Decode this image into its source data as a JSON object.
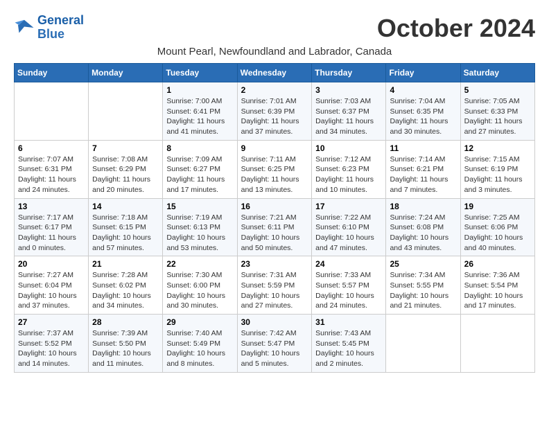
{
  "header": {
    "logo_line1": "General",
    "logo_line2": "Blue",
    "month": "October 2024",
    "subtitle": "Mount Pearl, Newfoundland and Labrador, Canada"
  },
  "weekdays": [
    "Sunday",
    "Monday",
    "Tuesday",
    "Wednesday",
    "Thursday",
    "Friday",
    "Saturday"
  ],
  "weeks": [
    [
      {
        "day": "",
        "info": ""
      },
      {
        "day": "",
        "info": ""
      },
      {
        "day": "1",
        "info": "Sunrise: 7:00 AM\nSunset: 6:41 PM\nDaylight: 11 hours and 41 minutes."
      },
      {
        "day": "2",
        "info": "Sunrise: 7:01 AM\nSunset: 6:39 PM\nDaylight: 11 hours and 37 minutes."
      },
      {
        "day": "3",
        "info": "Sunrise: 7:03 AM\nSunset: 6:37 PM\nDaylight: 11 hours and 34 minutes."
      },
      {
        "day": "4",
        "info": "Sunrise: 7:04 AM\nSunset: 6:35 PM\nDaylight: 11 hours and 30 minutes."
      },
      {
        "day": "5",
        "info": "Sunrise: 7:05 AM\nSunset: 6:33 PM\nDaylight: 11 hours and 27 minutes."
      }
    ],
    [
      {
        "day": "6",
        "info": "Sunrise: 7:07 AM\nSunset: 6:31 PM\nDaylight: 11 hours and 24 minutes."
      },
      {
        "day": "7",
        "info": "Sunrise: 7:08 AM\nSunset: 6:29 PM\nDaylight: 11 hours and 20 minutes."
      },
      {
        "day": "8",
        "info": "Sunrise: 7:09 AM\nSunset: 6:27 PM\nDaylight: 11 hours and 17 minutes."
      },
      {
        "day": "9",
        "info": "Sunrise: 7:11 AM\nSunset: 6:25 PM\nDaylight: 11 hours and 13 minutes."
      },
      {
        "day": "10",
        "info": "Sunrise: 7:12 AM\nSunset: 6:23 PM\nDaylight: 11 hours and 10 minutes."
      },
      {
        "day": "11",
        "info": "Sunrise: 7:14 AM\nSunset: 6:21 PM\nDaylight: 11 hours and 7 minutes."
      },
      {
        "day": "12",
        "info": "Sunrise: 7:15 AM\nSunset: 6:19 PM\nDaylight: 11 hours and 3 minutes."
      }
    ],
    [
      {
        "day": "13",
        "info": "Sunrise: 7:17 AM\nSunset: 6:17 PM\nDaylight: 11 hours and 0 minutes."
      },
      {
        "day": "14",
        "info": "Sunrise: 7:18 AM\nSunset: 6:15 PM\nDaylight: 10 hours and 57 minutes."
      },
      {
        "day": "15",
        "info": "Sunrise: 7:19 AM\nSunset: 6:13 PM\nDaylight: 10 hours and 53 minutes."
      },
      {
        "day": "16",
        "info": "Sunrise: 7:21 AM\nSunset: 6:11 PM\nDaylight: 10 hours and 50 minutes."
      },
      {
        "day": "17",
        "info": "Sunrise: 7:22 AM\nSunset: 6:10 PM\nDaylight: 10 hours and 47 minutes."
      },
      {
        "day": "18",
        "info": "Sunrise: 7:24 AM\nSunset: 6:08 PM\nDaylight: 10 hours and 43 minutes."
      },
      {
        "day": "19",
        "info": "Sunrise: 7:25 AM\nSunset: 6:06 PM\nDaylight: 10 hours and 40 minutes."
      }
    ],
    [
      {
        "day": "20",
        "info": "Sunrise: 7:27 AM\nSunset: 6:04 PM\nDaylight: 10 hours and 37 minutes."
      },
      {
        "day": "21",
        "info": "Sunrise: 7:28 AM\nSunset: 6:02 PM\nDaylight: 10 hours and 34 minutes."
      },
      {
        "day": "22",
        "info": "Sunrise: 7:30 AM\nSunset: 6:00 PM\nDaylight: 10 hours and 30 minutes."
      },
      {
        "day": "23",
        "info": "Sunrise: 7:31 AM\nSunset: 5:59 PM\nDaylight: 10 hours and 27 minutes."
      },
      {
        "day": "24",
        "info": "Sunrise: 7:33 AM\nSunset: 5:57 PM\nDaylight: 10 hours and 24 minutes."
      },
      {
        "day": "25",
        "info": "Sunrise: 7:34 AM\nSunset: 5:55 PM\nDaylight: 10 hours and 21 minutes."
      },
      {
        "day": "26",
        "info": "Sunrise: 7:36 AM\nSunset: 5:54 PM\nDaylight: 10 hours and 17 minutes."
      }
    ],
    [
      {
        "day": "27",
        "info": "Sunrise: 7:37 AM\nSunset: 5:52 PM\nDaylight: 10 hours and 14 minutes."
      },
      {
        "day": "28",
        "info": "Sunrise: 7:39 AM\nSunset: 5:50 PM\nDaylight: 10 hours and 11 minutes."
      },
      {
        "day": "29",
        "info": "Sunrise: 7:40 AM\nSunset: 5:49 PM\nDaylight: 10 hours and 8 minutes."
      },
      {
        "day": "30",
        "info": "Sunrise: 7:42 AM\nSunset: 5:47 PM\nDaylight: 10 hours and 5 minutes."
      },
      {
        "day": "31",
        "info": "Sunrise: 7:43 AM\nSunset: 5:45 PM\nDaylight: 10 hours and 2 minutes."
      },
      {
        "day": "",
        "info": ""
      },
      {
        "day": "",
        "info": ""
      }
    ]
  ]
}
